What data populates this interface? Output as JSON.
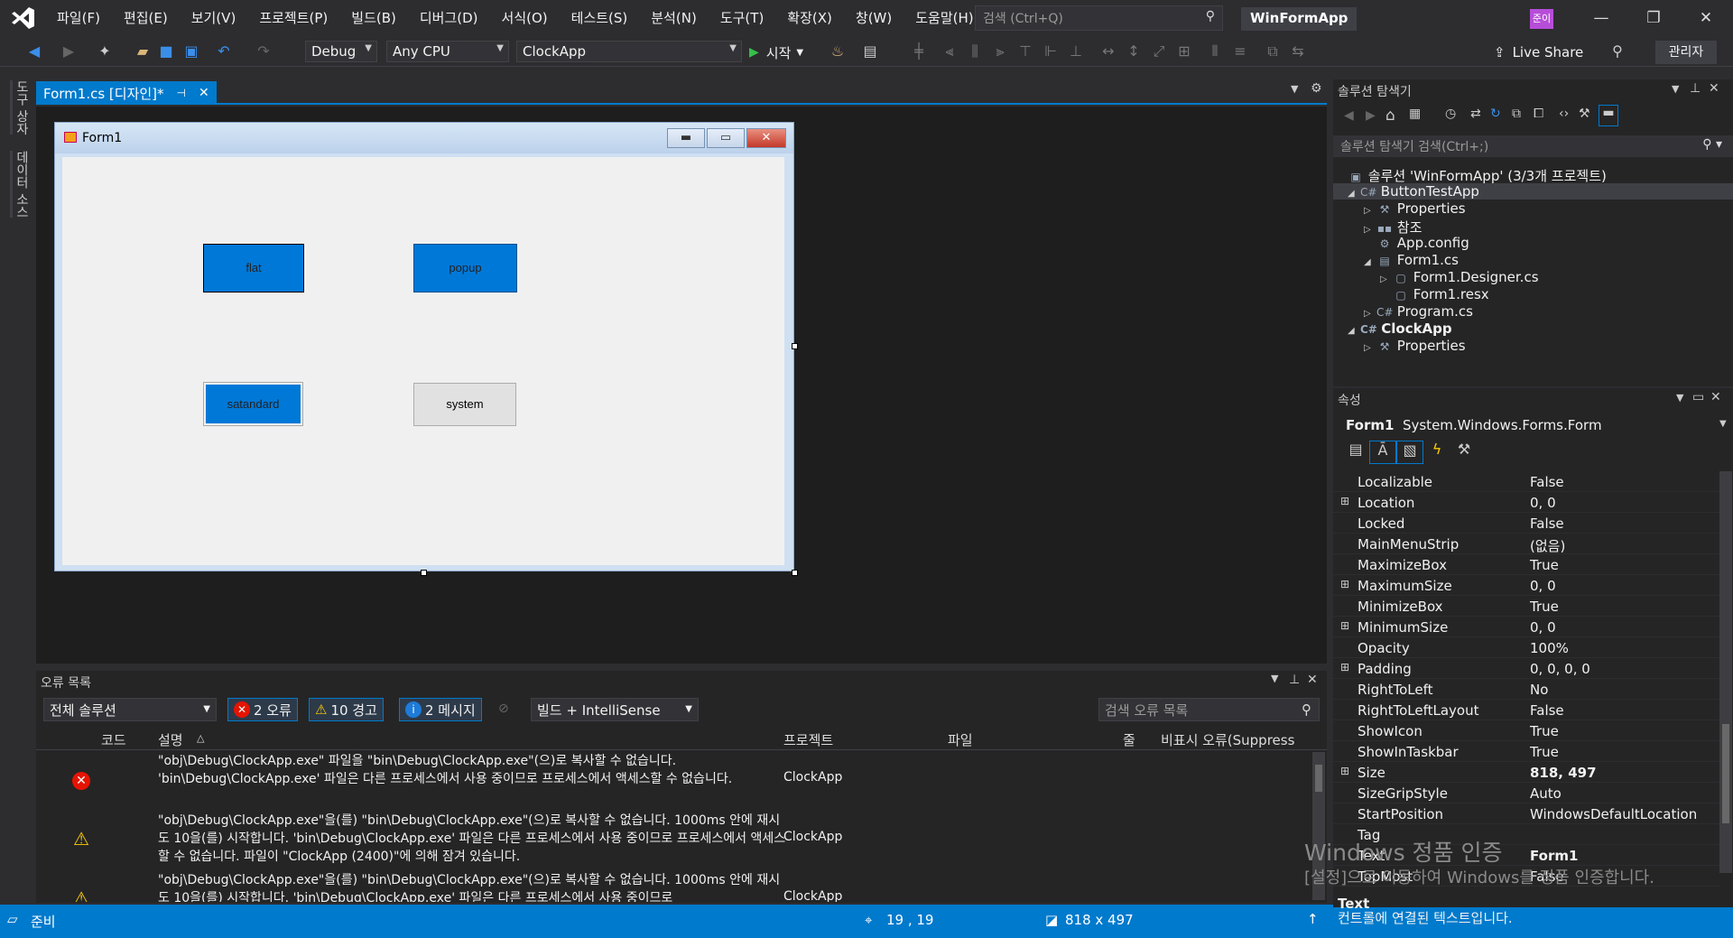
{
  "menu": [
    "파일(F)",
    "편집(E)",
    "보기(V)",
    "프로젝트(P)",
    "빌드(B)",
    "디버그(D)",
    "서식(O)",
    "테스트(S)",
    "분석(N)",
    "도구(T)",
    "확장(X)",
    "창(W)",
    "도움말(H)"
  ],
  "search": {
    "placeholder": "검색 (Ctrl+Q)"
  },
  "app_title": "WinFormApp",
  "user_badge": "준이",
  "toolbar": {
    "config": "Debug",
    "platform": "Any CPU",
    "startup": "ClockApp",
    "run_label": "시작",
    "live_share": "Live Share",
    "admin": "관리자"
  },
  "side_tabs": [
    "도구 상자",
    "데이터 소스"
  ],
  "doc_tab": {
    "label": "Form1.cs [디자인]*"
  },
  "form": {
    "title": "Form1",
    "buttons": {
      "flat": "flat",
      "popup": "popup",
      "standard": "satandard",
      "system": "system"
    }
  },
  "error_list": {
    "title": "오류 목록",
    "scope": "전체 솔루션",
    "errors": "2 오류",
    "warnings": "10 경고",
    "messages": "2 메시지",
    "build_filter": "빌드 + IntelliSense",
    "search_placeholder": "검색 오류 목록",
    "columns": {
      "code": "코드",
      "desc": "설명",
      "project": "프로젝트",
      "file": "파일",
      "line": "줄",
      "suppress": "비표시 오류(Suppress"
    },
    "rows": [
      {
        "type": "error",
        "desc": "\"obj\\Debug\\ClockApp.exe\" 파일을 \"bin\\Debug\\ClockApp.exe\"(으)로 복사할 수 없습니다. 'bin\\Debug\\ClockApp.exe' 파일은 다른 프로세스에서 사용 중이므로 프로세스에서 액세스할 수 없습니다.",
        "project": "ClockApp"
      },
      {
        "type": "warning",
        "desc": "\"obj\\Debug\\ClockApp.exe\"을(를) \"bin\\Debug\\ClockApp.exe\"(으)로 복사할 수 없습니다. 1000ms 안에 재시도 10을(를) 시작합니다. 'bin\\Debug\\ClockApp.exe' 파일은 다른 프로세스에서 사용 중이므로 프로세스에서 액세스할 수 없습니다. 파일이 \"ClockApp (2400)\"에 의해 잠겨 있습니다.",
        "project": "ClockApp"
      },
      {
        "type": "warning",
        "desc": "\"obj\\Debug\\ClockApp.exe\"을(를) \"bin\\Debug\\ClockApp.exe\"(으)로 복사할 수 없습니다. 1000ms 안에 재시도 10을(를) 시작합니다. 'bin\\Debug\\ClockApp.exe' 파일은 다른 프로세스에서 사용 중이므로",
        "project": "ClockApp"
      }
    ]
  },
  "status": {
    "ready": "준비",
    "position": "19 , 19",
    "size": "818 x 497"
  },
  "solution_explorer": {
    "title": "솔루션 탐색기",
    "search_placeholder": "솔루션 탐색기 검색(Ctrl+;)",
    "items": [
      {
        "label": "솔루션 'WinFormApp' (3/3개 프로젝트)"
      },
      {
        "label": "ButtonTestApp"
      },
      {
        "label": "Properties"
      },
      {
        "label": "참조"
      },
      {
        "label": "App.config"
      },
      {
        "label": "Form1.cs"
      },
      {
        "label": "Form1.Designer.cs"
      },
      {
        "label": "Form1.resx"
      },
      {
        "label": "Program.cs"
      },
      {
        "label": "ClockApp"
      },
      {
        "label": "Properties"
      }
    ]
  },
  "properties": {
    "title": "속성",
    "object_name": "Form1",
    "object_type": "System.Windows.Forms.Form",
    "rows": [
      {
        "name": "Localizable",
        "value": "False"
      },
      {
        "name": "Location",
        "value": "0, 0"
      },
      {
        "name": "Locked",
        "value": "False"
      },
      {
        "name": "MainMenuStrip",
        "value": "(없음)"
      },
      {
        "name": "MaximizeBox",
        "value": "True"
      },
      {
        "name": "MaximumSize",
        "value": "0, 0"
      },
      {
        "name": "MinimizeBox",
        "value": "True"
      },
      {
        "name": "MinimumSize",
        "value": "0, 0"
      },
      {
        "name": "Opacity",
        "value": "100%"
      },
      {
        "name": "Padding",
        "value": "0, 0, 0, 0"
      },
      {
        "name": "RightToLeft",
        "value": "No"
      },
      {
        "name": "RightToLeftLayout",
        "value": "False"
      },
      {
        "name": "ShowIcon",
        "value": "True"
      },
      {
        "name": "ShowInTaskbar",
        "value": "True"
      },
      {
        "name": "Size",
        "value": "818, 497"
      },
      {
        "name": "SizeGripStyle",
        "value": "Auto"
      },
      {
        "name": "StartPosition",
        "value": "WindowsDefaultLocation"
      },
      {
        "name": "Tag",
        "value": ""
      },
      {
        "name": "Text",
        "value": "Form1"
      },
      {
        "name": "TopMost",
        "value": "False"
      }
    ],
    "desc_title": "Text",
    "desc_text": "컨트롤에 연결된 텍스트입니다."
  },
  "watermark": {
    "line1": "Windows 정품 인증",
    "line2": "[설정]으로 이동하여 Windows를 정품 인증합니다."
  }
}
